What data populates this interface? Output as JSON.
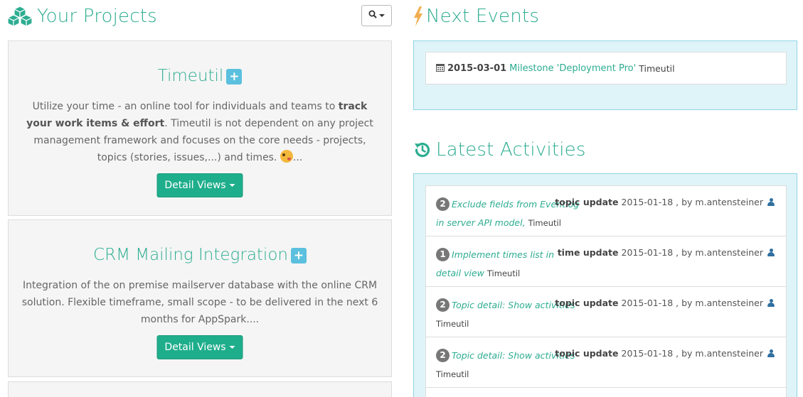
{
  "colors": {
    "accent": "#2dad91",
    "info_bg": "#dff4f8",
    "info_border": "#8fd5e6",
    "plus_bg": "#5bc0de",
    "button_bg": "#1fae8c"
  },
  "projects_section": {
    "title": "Your Projects",
    "icon": "cubes-icon",
    "search_icon": "search-icon",
    "projects": [
      {
        "title": "Timeutil",
        "desc_before_bold": "Utilize your time - an online tool for individuals and teams to ",
        "desc_bold": "track your work items & effort",
        "desc_after_bold": ". Timeutil is not dependent on any project management framework and focuses on the core needs - projects, topics (stories, issues,...) and times. ",
        "desc_emoji": "winking-tongue-emoji",
        "desc_end": "...",
        "button_label": "Detail Views"
      },
      {
        "title": "CRM Mailing Integration",
        "desc": "Integration of the on premise mailserver database with the online CRM solution. Flexible timeframe, small scope - to be delivered in the next 6 months for AppSpark....",
        "button_label": "Detail Views"
      }
    ]
  },
  "events_section": {
    "title": "Next Events",
    "icon": "bolt-icon",
    "events": [
      {
        "date": "2015-03-01",
        "text": "Milestone 'Deployment Pro'",
        "project": "Timeutil",
        "icon": "calendar-icon"
      }
    ]
  },
  "activities_section": {
    "title": "Latest Activities",
    "icon": "history-icon",
    "activities": [
      {
        "count": "2",
        "link": "Exclude fields from Eventlog in server API model,",
        "project": "Timeutil",
        "kind": "topic update",
        "date": "2015-01-18",
        "by": ", by m.antensteiner"
      },
      {
        "count": "1",
        "link": "Implement times list in detail view",
        "project": "Timeutil",
        "kind": "time update",
        "date": "2015-01-18",
        "by": ", by m.antensteiner"
      },
      {
        "count": "2",
        "link": "Topic detail: Show activities",
        "project": "Timeutil",
        "kind": "topic update",
        "date": "2015-01-18",
        "by": ", by m.antensteiner"
      },
      {
        "count": "2",
        "link": "Topic detail: Show activities",
        "project": "Timeutil",
        "kind": "topic update",
        "date": "2015-01-18",
        "by": ", by m.antensteiner"
      }
    ]
  }
}
